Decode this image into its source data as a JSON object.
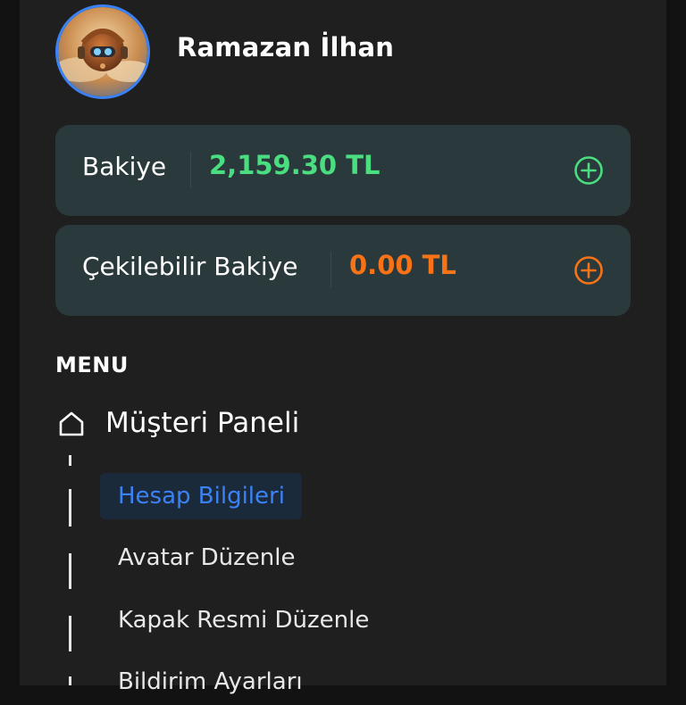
{
  "user": {
    "name": "Ramazan İlhan"
  },
  "balances": [
    {
      "label": "Bakiye",
      "value": "2,159.30 TL",
      "color": "#4ade80",
      "action_icon": "plus-circle-icon"
    },
    {
      "label": "Çekilebilir Bakiye",
      "value": "0.00 TL",
      "color": "#f97316",
      "action_icon": "plus-circle-icon"
    }
  ],
  "menu": {
    "title": "MENU",
    "main_item": {
      "label": "Müşteri Paneli",
      "icon": "home-icon"
    },
    "sub_items": [
      {
        "label": "Hesap Bilgileri",
        "active": true
      },
      {
        "label": "Avatar Düzenle",
        "active": false
      },
      {
        "label": "Kapak Resmi Düzenle",
        "active": false
      },
      {
        "label": "Bildirim Ayarları",
        "active": false
      }
    ]
  },
  "colors": {
    "accent_blue": "#3b82f6",
    "card_bg": "#2a3a3c",
    "panel_bg": "#1f1f1f"
  }
}
